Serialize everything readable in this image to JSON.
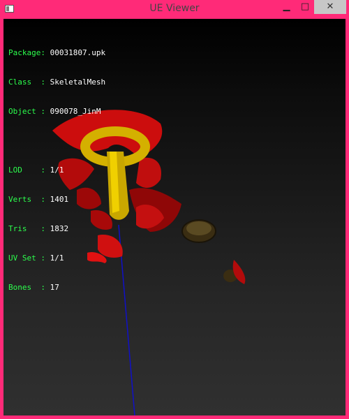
{
  "window": {
    "title": "UE Viewer",
    "min_label": "▁",
    "max_label": "□",
    "close_label": "✕"
  },
  "info": {
    "package_label": "Package:",
    "package_value": "00031807.upk",
    "class_label": "Class  :",
    "class_value": "SkeletalMesh",
    "object_label": "Object :",
    "object_value": "090078_JinM",
    "lod_label": "LOD    :",
    "lod_value": "1/1",
    "verts_label": "Verts  :",
    "verts_value": "1401",
    "tris_label": "Tris   :",
    "tris_value": "1832",
    "uvset_label": "UV Set :",
    "uvset_value": "1/1",
    "bones_label": "Bones  :",
    "bones_value": "17"
  },
  "colors": {
    "accent": "#ff2a78",
    "label": "#2cff4d",
    "value": "#ffffff",
    "axis": "#1010c8"
  }
}
